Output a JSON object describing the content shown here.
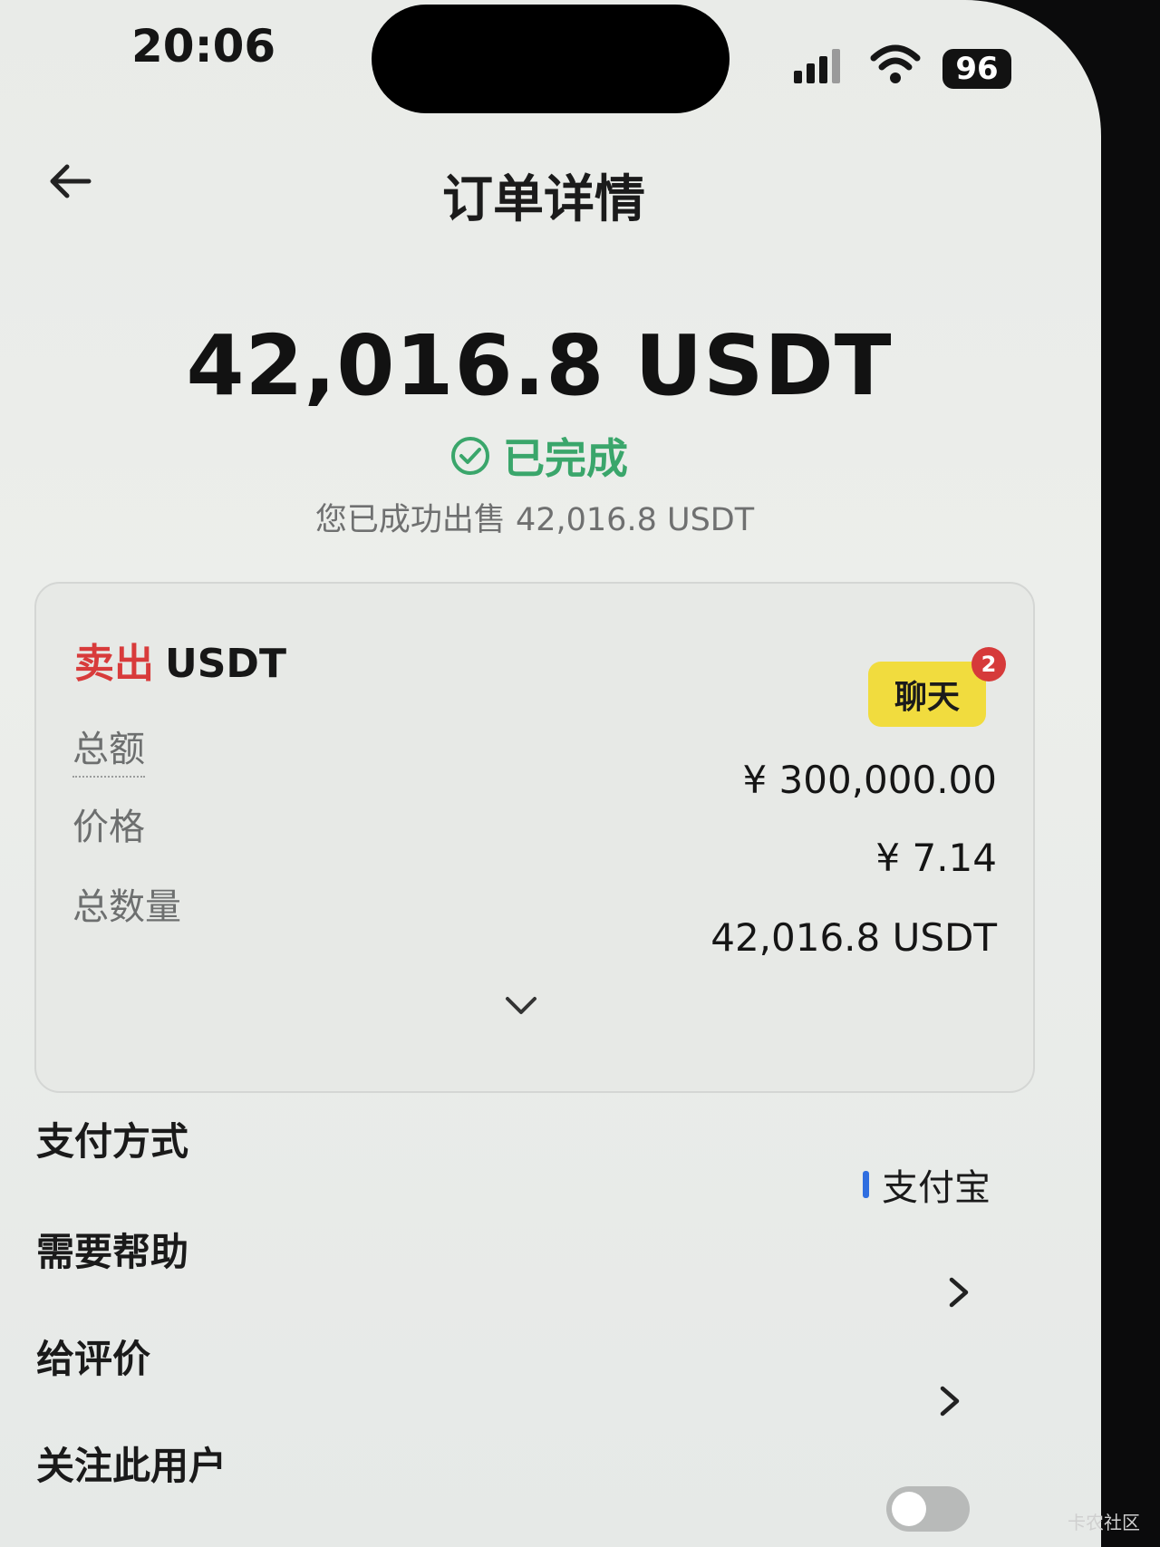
{
  "status_bar": {
    "time": "20:06",
    "battery": "96"
  },
  "header": {
    "title": "订单详情"
  },
  "summary": {
    "amount": "42,016.8 USDT",
    "status": "已完成",
    "subtitle": "您已成功出售 42,016.8 USDT"
  },
  "card": {
    "side": "卖出",
    "asset": "USDT",
    "chat_label": "聊天",
    "chat_badge": "2",
    "rows": [
      {
        "label": "总额",
        "value": "¥ 300,000.00"
      },
      {
        "label": "价格",
        "value": "¥ 7.14"
      },
      {
        "label": "总数量",
        "value": "42,016.8 USDT"
      }
    ]
  },
  "list": {
    "payment_label": "支付方式",
    "payment_value": "支付宝",
    "help_label": "需要帮助",
    "review_label": "给评价",
    "follow_label": "关注此用户"
  },
  "watermark": "卡农社区",
  "colors": {
    "sell": "#d83b3b",
    "completed": "#3aa66b",
    "chat_button": "#f1dc3e",
    "payment_accent": "#2f6ee0"
  }
}
